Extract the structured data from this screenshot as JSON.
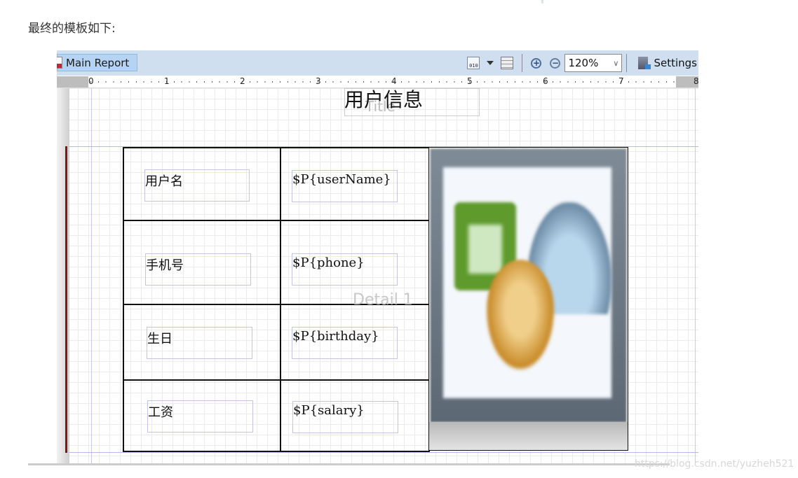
{
  "intro_text": "最终的模板如下:",
  "toolbar": {
    "tab_label": "Main Report",
    "zoom_value": "120%",
    "settings_label": "Settings",
    "icons": [
      "report-doc-icon",
      "binary-data-icon",
      "dropdown-caret-icon",
      "list-view-icon",
      "zoom-in-icon",
      "zoom-out-icon",
      "settings-icon"
    ]
  },
  "ruler": {
    "marks": [
      "0",
      "1",
      "2",
      "3",
      "4",
      "5",
      "6",
      "7",
      "8"
    ]
  },
  "report": {
    "title_text": "用户信息",
    "title_band_label": "Title",
    "detail_band_label": "Detail 1",
    "rows": [
      {
        "label": "用户名",
        "param": "$P{userName}"
      },
      {
        "label": "手机号",
        "param": "$P{phone}"
      },
      {
        "label": "生日",
        "param": "$P{birthday}"
      },
      {
        "label": "工资",
        "param": "$P{salary}"
      }
    ],
    "image_placeholder": "image-placeholder-icon"
  },
  "watermark": "https://blog.csdn.net/yuzheh521"
}
